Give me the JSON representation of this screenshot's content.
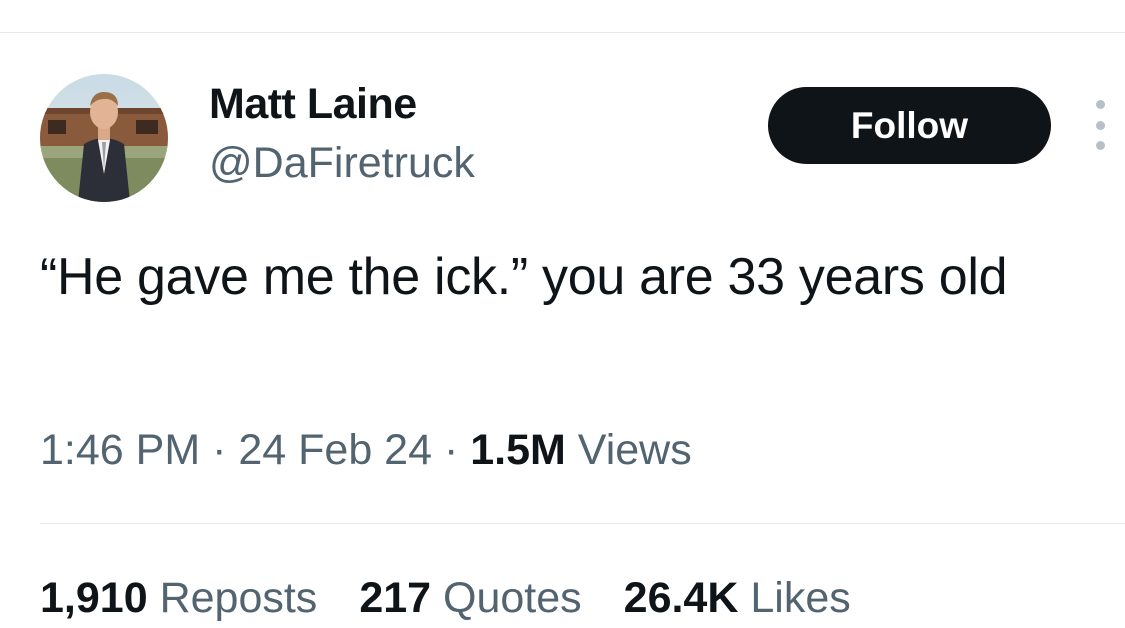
{
  "author": {
    "display_name": "Matt Laine",
    "handle": "@DaFiretruck",
    "avatar_icon": "profile-photo"
  },
  "actions": {
    "follow_label": "Follow",
    "more_icon": "more-vertical-icon"
  },
  "tweet": {
    "text": "“He gave me the ick.” you are 33 years old"
  },
  "meta": {
    "time": "1:46 PM",
    "separator": " · ",
    "date": "24 Feb 24",
    "views_count": "1.5M",
    "views_label": "Views"
  },
  "stats": [
    {
      "count": "1,910",
      "label": "Reposts"
    },
    {
      "count": "217",
      "label": "Quotes"
    },
    {
      "count": "26.4K",
      "label": "Likes"
    }
  ],
  "colors": {
    "text_primary": "#0f1419",
    "text_secondary": "#536471",
    "divider": "#e6e9ec",
    "follow_bg": "#0f1419",
    "follow_text": "#ffffff"
  }
}
